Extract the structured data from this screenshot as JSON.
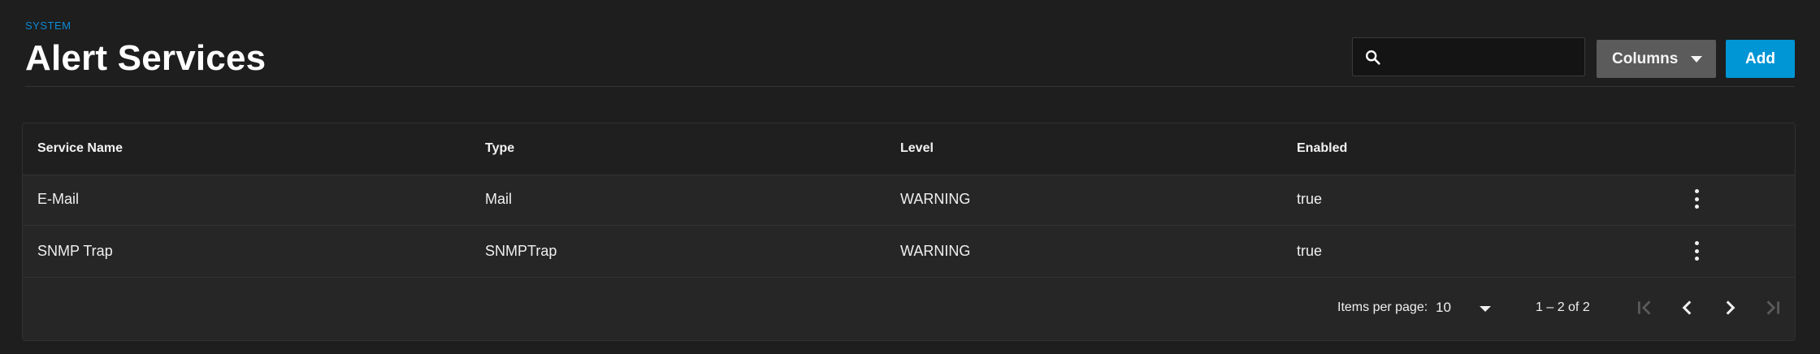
{
  "header": {
    "breadcrumb": "SYSTEM",
    "title": "Alert Services"
  },
  "toolbar": {
    "search_value": "",
    "search_placeholder": "",
    "columns_label": "Columns",
    "add_label": "Add"
  },
  "table": {
    "columns": [
      "Service Name",
      "Type",
      "Level",
      "Enabled"
    ],
    "rows": [
      {
        "name": "E-Mail",
        "type": "Mail",
        "level": "WARNING",
        "enabled": "true"
      },
      {
        "name": "SNMP Trap",
        "type": "SNMPTrap",
        "level": "WARNING",
        "enabled": "true"
      }
    ]
  },
  "paginator": {
    "items_per_page_label": "Items per page:",
    "items_per_page_value": "10",
    "range_label": "1 – 2 of 2"
  },
  "colors": {
    "accent": "#0095d5",
    "breadcrumb": "#0c8ad6",
    "background": "#1e1e1e",
    "card": "#262626"
  },
  "icons": {
    "search": "search-icon",
    "columns_dropdown": "chevron-down-icon",
    "row_menu": "more-vertical-icon",
    "first_page": "first-page-icon",
    "previous_page": "chevron-left-icon",
    "next_page": "chevron-right-icon",
    "last_page": "last-page-icon"
  }
}
